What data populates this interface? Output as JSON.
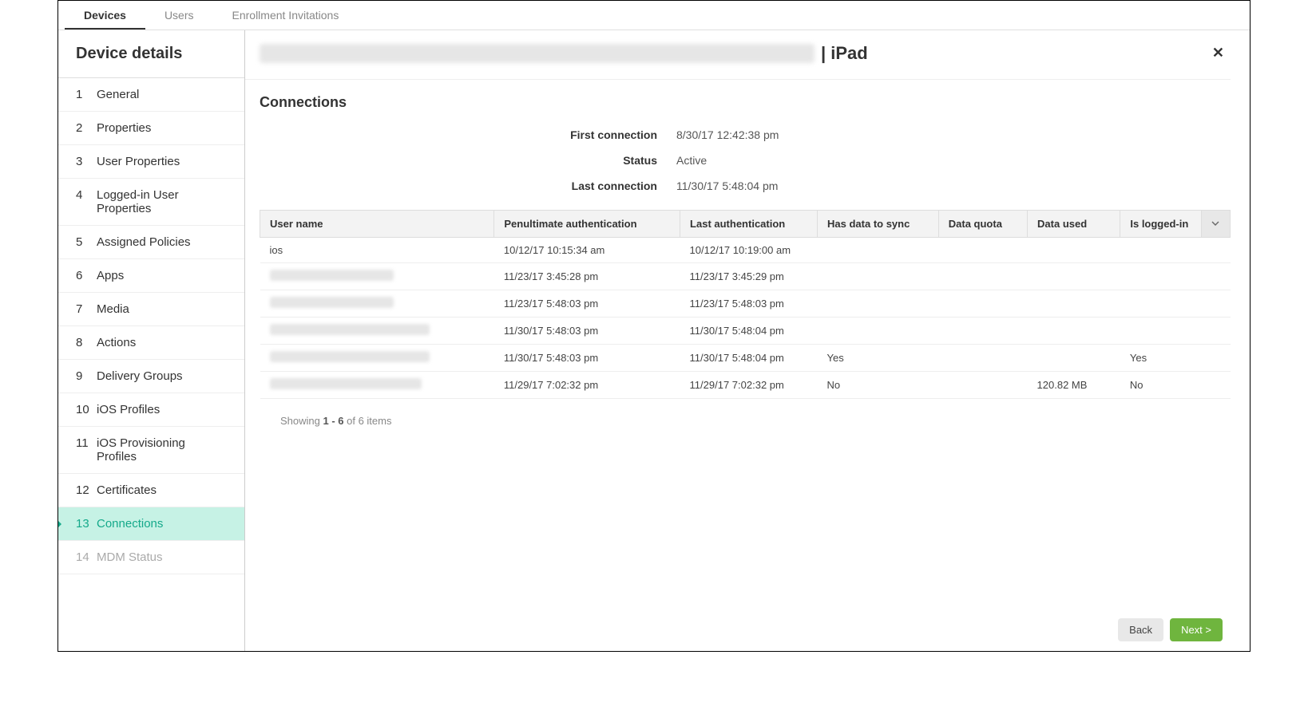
{
  "tabs": {
    "devices": "Devices",
    "users": "Users",
    "enroll": "Enrollment Invitations"
  },
  "sidebar": {
    "title": "Device details",
    "items": [
      {
        "num": "1",
        "label": "General"
      },
      {
        "num": "2",
        "label": "Properties"
      },
      {
        "num": "3",
        "label": "User Properties"
      },
      {
        "num": "4",
        "label": "Logged-in User Properties"
      },
      {
        "num": "5",
        "label": "Assigned Policies"
      },
      {
        "num": "6",
        "label": "Apps"
      },
      {
        "num": "7",
        "label": "Media"
      },
      {
        "num": "8",
        "label": "Actions"
      },
      {
        "num": "9",
        "label": "Delivery Groups"
      },
      {
        "num": "10",
        "label": "iOS Profiles"
      },
      {
        "num": "11",
        "label": "iOS Provisioning Profiles"
      },
      {
        "num": "12",
        "label": "Certificates"
      },
      {
        "num": "13",
        "label": "Connections"
      },
      {
        "num": "14",
        "label": "MDM Status"
      }
    ]
  },
  "header": {
    "title": "|  iPad"
  },
  "section": {
    "title": "Connections",
    "info": [
      {
        "label": "First connection",
        "value": "8/30/17 12:42:38 pm"
      },
      {
        "label": "Status",
        "value": "Active"
      },
      {
        "label": "Last connection",
        "value": "11/30/17 5:48:04 pm"
      }
    ]
  },
  "table": {
    "headers": {
      "user": "User name",
      "penult": "Penultimate authentication",
      "last": "Last authentication",
      "sync": "Has data to sync",
      "quota": "Data quota",
      "used": "Data used",
      "logged": "Is logged-in"
    },
    "rows": [
      {
        "user": "ios",
        "user_blur": false,
        "blur_w": 0,
        "penult": "10/12/17 10:15:34 am",
        "last": "10/12/17 10:19:00 am",
        "sync": "",
        "quota": "",
        "used": "",
        "logged": ""
      },
      {
        "user": "",
        "user_blur": true,
        "blur_w": 155,
        "penult": "11/23/17 3:45:28 pm",
        "last": "11/23/17 3:45:29 pm",
        "sync": "",
        "quota": "",
        "used": "",
        "logged": ""
      },
      {
        "user": "",
        "user_blur": true,
        "blur_w": 155,
        "penult": "11/23/17 5:48:03 pm",
        "last": "11/23/17 5:48:03 pm",
        "sync": "",
        "quota": "",
        "used": "",
        "logged": ""
      },
      {
        "user": "",
        "user_blur": true,
        "blur_w": 200,
        "penult": "11/30/17 5:48:03 pm",
        "last": "11/30/17 5:48:04 pm",
        "sync": "",
        "quota": "",
        "used": "",
        "logged": ""
      },
      {
        "user": "",
        "user_blur": true,
        "blur_w": 200,
        "penult": "11/30/17 5:48:03 pm",
        "last": "11/30/17 5:48:04 pm",
        "sync": "Yes",
        "quota": "",
        "used": "",
        "logged": "Yes"
      },
      {
        "user": "",
        "user_blur": true,
        "blur_w": 190,
        "penult": "11/29/17 7:02:32 pm",
        "last": "11/29/17 7:02:32 pm",
        "sync": "No",
        "quota": "",
        "used": "120.82 MB",
        "logged": "No"
      }
    ]
  },
  "pager": {
    "prefix": "Showing ",
    "range": "1 - 6",
    "suffix": " of 6 items"
  },
  "footer": {
    "back": "Back",
    "next": "Next >"
  }
}
